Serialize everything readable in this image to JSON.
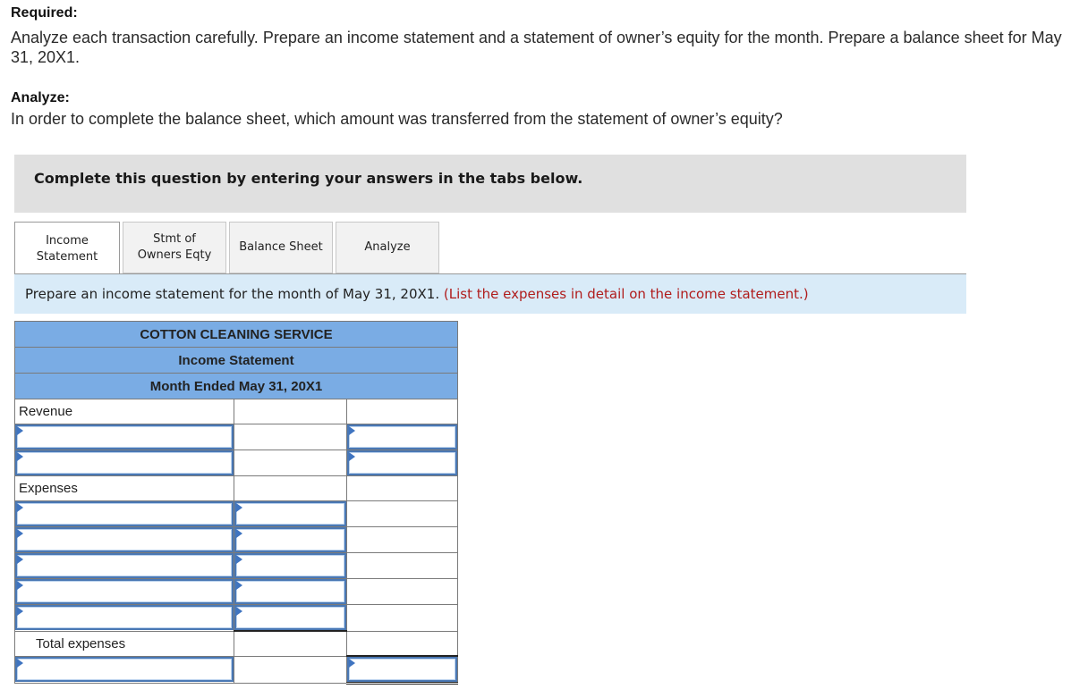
{
  "required": {
    "label": "Required:",
    "text": "Analyze each transaction carefully. Prepare an income statement and a statement of owner’s equity for the month. Prepare a balance sheet for May 31, 20X1."
  },
  "analyze": {
    "label": "Analyze:",
    "text": "In order to complete the balance sheet, which amount was transferred from the statement of owner’s equity?"
  },
  "complete_banner": "Complete this question by entering your answers in the tabs below.",
  "tabs": [
    {
      "label": "Income Statement",
      "active": true
    },
    {
      "label": "Stmt of Owners Eqty",
      "active": false
    },
    {
      "label": "Balance Sheet",
      "active": false
    },
    {
      "label": "Analyze",
      "active": false
    }
  ],
  "instruction": {
    "text": "Prepare an income statement for the month of May 31, 20X1.",
    "note": "(List the expenses in detail on the income statement.)"
  },
  "statement": {
    "company": "COTTON CLEANING SERVICE",
    "title": "Income Statement",
    "period": "Month Ended May 31, 20X1",
    "revenue_label": "Revenue",
    "revenue_rows": [
      {
        "account": "",
        "amount": ""
      },
      {
        "account": "",
        "amount": ""
      }
    ],
    "expenses_label": "Expenses",
    "expense_rows": [
      {
        "account": "",
        "amount": ""
      },
      {
        "account": "",
        "amount": ""
      },
      {
        "account": "",
        "amount": ""
      },
      {
        "account": "",
        "amount": ""
      },
      {
        "account": "",
        "amount": ""
      }
    ],
    "total_expenses_label": "Total expenses",
    "final_row": {
      "account": "",
      "amount": ""
    }
  },
  "colors": {
    "header_blue": "#7aace4",
    "instruction_bg": "#d9ebf8",
    "banner_gray": "#e0e0e0",
    "note_red": "#b01c1c",
    "input_border": "#4a78b4"
  }
}
